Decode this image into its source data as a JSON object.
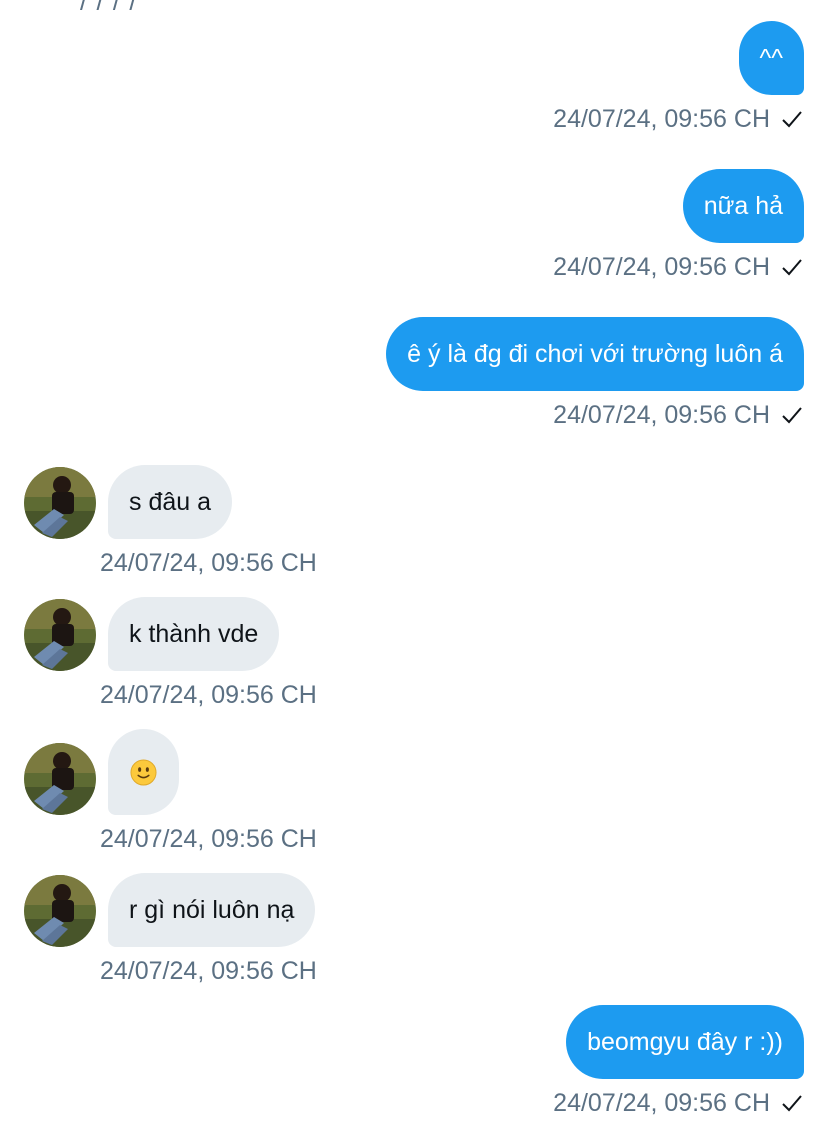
{
  "top_partial": "/ / / /",
  "messages": [
    {
      "dir": "out",
      "text": "^^",
      "time": "24/07/24, 09:56 CH"
    },
    {
      "dir": "out",
      "text": "nữa hả",
      "time": "24/07/24, 09:56 CH"
    },
    {
      "dir": "out",
      "text": "ê ý là đg đi chơi với trường luôn á",
      "time": "24/07/24, 09:56 CH"
    },
    {
      "dir": "in",
      "text": "s đâu a",
      "time": "24/07/24, 09:56 CH"
    },
    {
      "dir": "in",
      "text": "k thành vde",
      "time": "24/07/24, 09:56 CH"
    },
    {
      "dir": "in",
      "text": "",
      "icon": "slightly-smiling-face-icon",
      "time": "24/07/24, 09:56 CH"
    },
    {
      "dir": "in",
      "text": "r gì nói luôn nạ",
      "time": "24/07/24, 09:56 CH"
    },
    {
      "dir": "out",
      "text": "beomgyu đây r :))",
      "time": "24/07/24, 09:56 CH"
    }
  ],
  "colors": {
    "outgoing_bubble": "#1d9bf0",
    "incoming_bubble": "#e7ecf0",
    "timestamp": "#5b7083"
  },
  "icons": {
    "read_receipt": "checkmark-icon",
    "avatar": "avatar"
  }
}
